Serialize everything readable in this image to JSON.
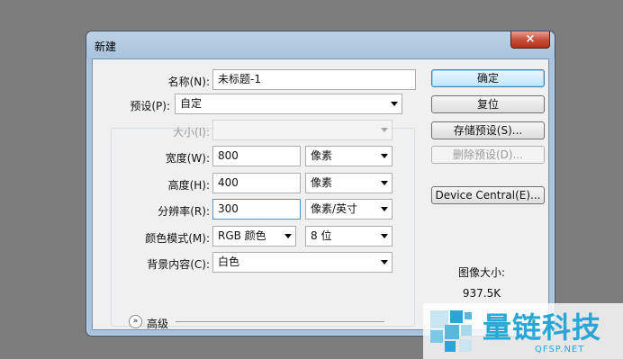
{
  "window": {
    "title": "新建",
    "close_glyph": "×"
  },
  "form": {
    "name": {
      "label": "名称(N):",
      "value": "未标题-1"
    },
    "preset": {
      "label": "预设(P):",
      "value": "自定"
    },
    "size": {
      "label": "大小(I):",
      "value": ""
    },
    "width": {
      "label": "宽度(W):",
      "value": "800",
      "unit": "像素"
    },
    "height": {
      "label": "高度(H):",
      "value": "400",
      "unit": "像素"
    },
    "resolution": {
      "label": "分辨率(R):",
      "value": "300",
      "unit": "像素/英寸"
    },
    "color_mode": {
      "label": "颜色模式(M):",
      "value": "RGB 颜色",
      "bits": "8 位"
    },
    "background": {
      "label": "背景内容(C):",
      "value": "白色"
    },
    "advanced": {
      "label": "高级",
      "icon": "double-chevron-down"
    }
  },
  "buttons": {
    "ok": "确定",
    "reset": "复位",
    "save_preset": "存储预设(S)...",
    "delete_preset": "删除预设(D)...",
    "device_central": "Device Central(E)..."
  },
  "image_size": {
    "label": "图像大小:",
    "value": "937.5K"
  },
  "watermark": {
    "text": "量链科技",
    "url": "QFSP.NET"
  },
  "colors": {
    "desktop": "#7d7d7d",
    "frame": "#a9c3dc",
    "client": "#f0f0f0",
    "brand": "#2aa6d6"
  }
}
